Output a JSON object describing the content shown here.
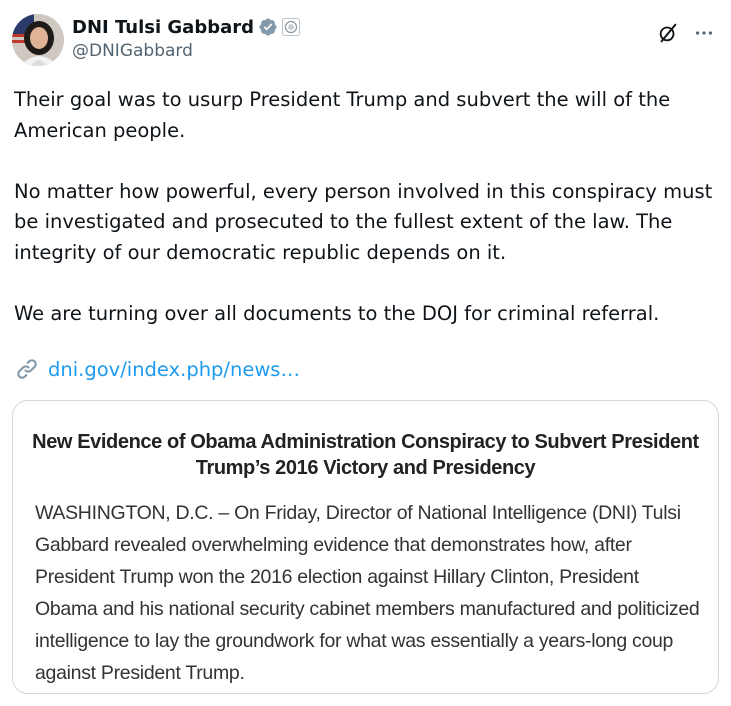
{
  "author": {
    "display_name": "DNI Tulsi Gabbard",
    "handle": "@DNIGabbard"
  },
  "icons": {
    "verified": "verified-badge-icon",
    "affiliate": "affiliate-badge-icon",
    "grok": "grok-icon",
    "more": "more-icon",
    "link": "link-icon"
  },
  "colors": {
    "accent": "#1d9bf0",
    "verified_badge": "#829aab",
    "text": "#0f1419",
    "muted": "#536471"
  },
  "tweet": {
    "paragraphs": [
      "Their goal was to usurp President Trump and subvert the will of the American people.",
      "No matter how powerful, every person involved in this conspiracy must be investigated and prosecuted to the fullest extent of the law. The integrity of our democratic republic depends on it.",
      "We are turning over all documents to the DOJ for criminal referral."
    ],
    "link_text": "dni.gov/index.php/news…"
  },
  "card": {
    "title_line1": "New Evidence of Obama Administration Conspiracy to Subvert President",
    "title_line2": "Trump’s 2016 Victory and Presidency",
    "body": "WASHINGTON, D.C. – On Friday, Director of National Intelligence (DNI) Tulsi Gabbard revealed overwhelming evidence that demonstrates how, after President Trump won the 2016 election against Hillary Clinton, President Obama and his national security cabinet members manufactured and politicized intelligence to lay the groundwork for what was essentially a years-long coup against President Trump."
  }
}
